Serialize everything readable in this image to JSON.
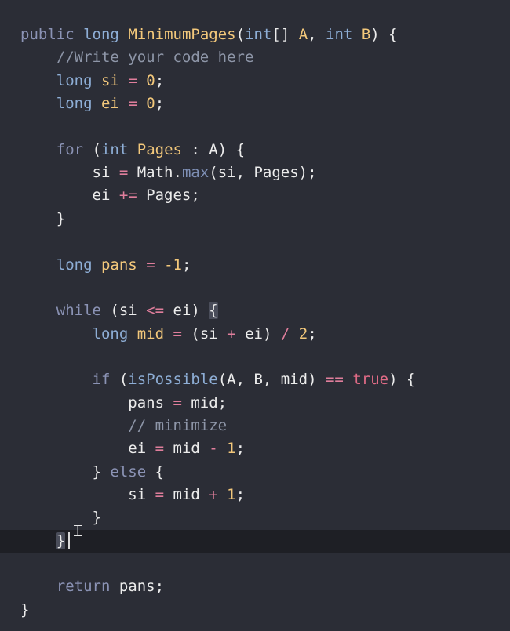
{
  "editor": {
    "lines": [
      {
        "tokens": [
          [
            "kw",
            "public"
          ],
          [
            "plain",
            " "
          ],
          [
            "type",
            "long"
          ],
          [
            "plain",
            " "
          ],
          [
            "fn",
            "MinimumPages"
          ],
          [
            "plain",
            "("
          ],
          [
            "type",
            "int"
          ],
          [
            "plain",
            "[] "
          ],
          [
            "param",
            "A"
          ],
          [
            "plain",
            ", "
          ],
          [
            "type",
            "int"
          ],
          [
            "plain",
            " "
          ],
          [
            "param",
            "B"
          ],
          [
            "plain",
            ") {"
          ]
        ]
      },
      {
        "tokens": [
          [
            "plain",
            "    "
          ],
          [
            "comment",
            "//Write your code here"
          ]
        ]
      },
      {
        "tokens": [
          [
            "plain",
            "    "
          ],
          [
            "type",
            "long"
          ],
          [
            "plain",
            " "
          ],
          [
            "var",
            "si"
          ],
          [
            "plain",
            " "
          ],
          [
            "op",
            "="
          ],
          [
            "plain",
            " "
          ],
          [
            "num",
            "0"
          ],
          [
            "plain",
            ";"
          ]
        ]
      },
      {
        "tokens": [
          [
            "plain",
            "    "
          ],
          [
            "type",
            "long"
          ],
          [
            "plain",
            " "
          ],
          [
            "var",
            "ei"
          ],
          [
            "plain",
            " "
          ],
          [
            "op",
            "="
          ],
          [
            "plain",
            " "
          ],
          [
            "num",
            "0"
          ],
          [
            "plain",
            ";"
          ]
        ]
      },
      {
        "tokens": []
      },
      {
        "tokens": [
          [
            "plain",
            "    "
          ],
          [
            "kw",
            "for"
          ],
          [
            "plain",
            " ("
          ],
          [
            "type",
            "int"
          ],
          [
            "plain",
            " "
          ],
          [
            "var",
            "Pages"
          ],
          [
            "plain",
            " : A) {"
          ]
        ]
      },
      {
        "tokens": [
          [
            "plain",
            "        si "
          ],
          [
            "op",
            "="
          ],
          [
            "plain",
            " Math."
          ],
          [
            "method",
            "max"
          ],
          [
            "plain",
            "(si, Pages);"
          ]
        ]
      },
      {
        "tokens": [
          [
            "plain",
            "        ei "
          ],
          [
            "op",
            "+="
          ],
          [
            "plain",
            " Pages;"
          ]
        ]
      },
      {
        "tokens": [
          [
            "plain",
            "    }"
          ]
        ]
      },
      {
        "tokens": []
      },
      {
        "tokens": [
          [
            "plain",
            "    "
          ],
          [
            "type",
            "long"
          ],
          [
            "plain",
            " "
          ],
          [
            "var",
            "pans"
          ],
          [
            "plain",
            " "
          ],
          [
            "op",
            "="
          ],
          [
            "plain",
            " "
          ],
          [
            "num",
            "-1"
          ],
          [
            "plain",
            ";"
          ]
        ]
      },
      {
        "tokens": []
      },
      {
        "tokens": [
          [
            "plain",
            "    "
          ],
          [
            "kw",
            "while"
          ],
          [
            "plain",
            " (si "
          ],
          [
            "op",
            "<="
          ],
          [
            "plain",
            " ei) "
          ],
          [
            "bracket",
            "{"
          ]
        ]
      },
      {
        "tokens": [
          [
            "plain",
            "        "
          ],
          [
            "type",
            "long"
          ],
          [
            "plain",
            " "
          ],
          [
            "var",
            "mid"
          ],
          [
            "plain",
            " "
          ],
          [
            "op",
            "="
          ],
          [
            "plain",
            " (si "
          ],
          [
            "op",
            "+"
          ],
          [
            "plain",
            " ei) "
          ],
          [
            "op",
            "/"
          ],
          [
            "plain",
            " "
          ],
          [
            "num",
            "2"
          ],
          [
            "plain",
            ";"
          ]
        ]
      },
      {
        "tokens": []
      },
      {
        "tokens": [
          [
            "plain",
            "        "
          ],
          [
            "kw",
            "if"
          ],
          [
            "plain",
            " ("
          ],
          [
            "callfn",
            "isPossible"
          ],
          [
            "plain",
            "(A, B, mid) "
          ],
          [
            "op",
            "=="
          ],
          [
            "plain",
            " "
          ],
          [
            "bool",
            "true"
          ],
          [
            "plain",
            ") {"
          ]
        ]
      },
      {
        "tokens": [
          [
            "plain",
            "            pans "
          ],
          [
            "op",
            "="
          ],
          [
            "plain",
            " mid;"
          ]
        ]
      },
      {
        "tokens": [
          [
            "plain",
            "            "
          ],
          [
            "comment",
            "// minimize"
          ]
        ]
      },
      {
        "tokens": [
          [
            "plain",
            "            ei "
          ],
          [
            "op",
            "="
          ],
          [
            "plain",
            " mid "
          ],
          [
            "op",
            "-"
          ],
          [
            "plain",
            " "
          ],
          [
            "num",
            "1"
          ],
          [
            "plain",
            ";"
          ]
        ]
      },
      {
        "tokens": [
          [
            "plain",
            "        } "
          ],
          [
            "kw",
            "else"
          ],
          [
            "plain",
            " {"
          ]
        ]
      },
      {
        "tokens": [
          [
            "plain",
            "            si "
          ],
          [
            "op",
            "="
          ],
          [
            "plain",
            " mid "
          ],
          [
            "op",
            "+"
          ],
          [
            "plain",
            " "
          ],
          [
            "num",
            "1"
          ],
          [
            "plain",
            ";"
          ]
        ]
      },
      {
        "tokens": [
          [
            "plain",
            "        }"
          ]
        ]
      },
      {
        "tokens": [
          [
            "plain",
            "    "
          ],
          [
            "bracket",
            "}"
          ]
        ],
        "active": true
      },
      {
        "tokens": []
      },
      {
        "tokens": [
          [
            "plain",
            "    "
          ],
          [
            "kw",
            "return"
          ],
          [
            "plain",
            " pans;"
          ]
        ]
      },
      {
        "tokens": [
          [
            "plain",
            "}"
          ]
        ]
      }
    ]
  },
  "colors": {
    "background": "#2b2d36",
    "active_line": "#1e1f25",
    "keyword": "#8b93b5",
    "type": "#8eaed6",
    "identifier_decl": "#f3c87b",
    "operator": "#e07e9c",
    "boolean": "#e06b86",
    "comment": "#8e96a8",
    "plain": "#ececec"
  },
  "icons": {
    "mouse_pointer": "i-beam-cursor-icon"
  }
}
